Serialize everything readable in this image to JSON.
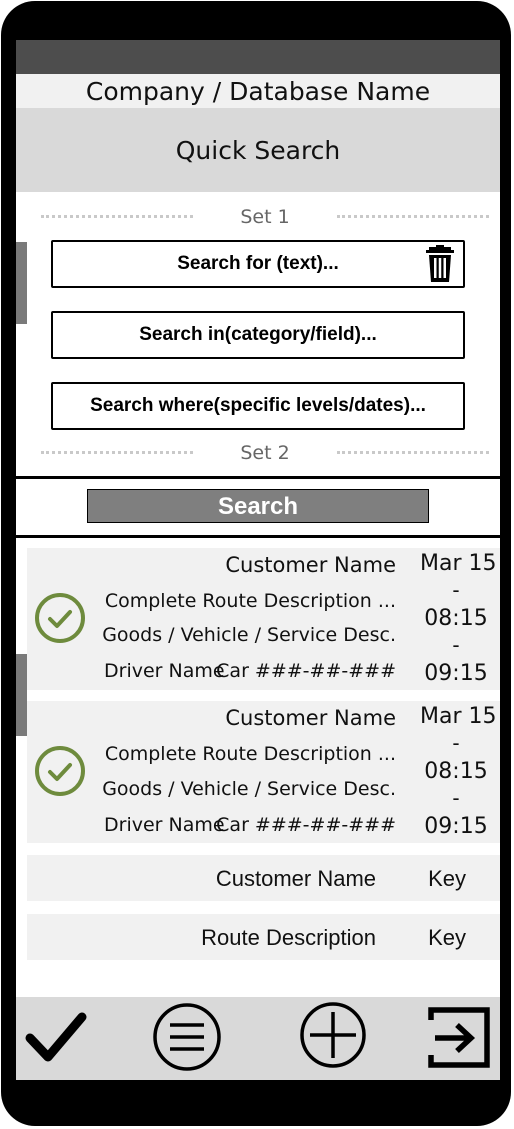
{
  "header": {
    "company": "Company / Database Name",
    "quick_search": "Quick Search"
  },
  "search_form": {
    "set1_label": "Set 1",
    "set2_label": "Set 2",
    "fields": [
      {
        "label": "Search for (text)...",
        "icon": "trash-icon"
      },
      {
        "label": "Search in(category/field)..."
      },
      {
        "label": "Search where(specific levels/dates)..."
      }
    ],
    "search_button": "Search"
  },
  "results": {
    "detailed": [
      {
        "status_icon": "check-circle-icon",
        "customer": "Customer Name",
        "route": "Complete Route Description ...",
        "goods": "Goods / Vehicle / Service Desc.",
        "driver": "Driver Name",
        "car": "Car ###-##-###",
        "date": "Mar 15",
        "dash1": "-",
        "time_start": "08:15",
        "dash2": "-",
        "time_end": "09:15"
      },
      {
        "status_icon": "check-circle-icon",
        "customer": "Customer Name",
        "route": "Complete Route Description ...",
        "goods": "Goods / Vehicle / Service Desc.",
        "driver": "Driver Name",
        "car": "Car ###-##-###",
        "date": "Mar 15",
        "dash1": "-",
        "time_start": "08:15",
        "dash2": "-",
        "time_end": "09:15"
      }
    ],
    "simple": [
      {
        "label": "Customer Name",
        "key": "Key"
      },
      {
        "label": "Route Description",
        "key": "Key"
      }
    ]
  },
  "bottom_nav": [
    "checkmark-icon",
    "menu-icon",
    "add-icon",
    "exit-icon"
  ],
  "colors": {
    "status_bar": "#4d4d4d",
    "header_bg": "#d9d9d9",
    "search_button": "#7f7f7f",
    "check_green": "#6e8b3d",
    "card_bg": "#f1f1f1"
  }
}
